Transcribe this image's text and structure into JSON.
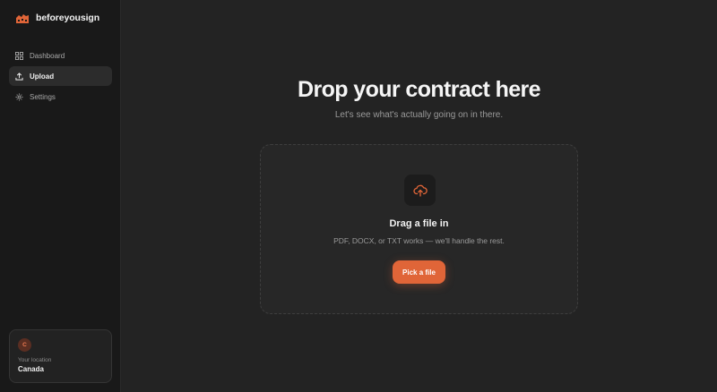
{
  "brand": {
    "name": "beforeyousign",
    "logo_icon": "building-logo-icon",
    "accent": "#e06538"
  },
  "sidebar": {
    "items": [
      {
        "label": "Dashboard",
        "icon": "grid-icon",
        "active": false
      },
      {
        "label": "Upload",
        "icon": "upload-icon",
        "active": true
      },
      {
        "label": "Settings",
        "icon": "gear-icon",
        "active": false
      }
    ],
    "location": {
      "avatar_initial": "C",
      "caption": "Your location",
      "value": "Canada"
    }
  },
  "main": {
    "title": "Drop your contract here",
    "subtitle": "Let's see what's actually going on in there.",
    "dropzone": {
      "icon": "cloud-upload-icon",
      "title": "Drag a file in",
      "hint": "PDF, DOCX, or TXT works — we'll handle the rest.",
      "button_label": "Pick a file"
    }
  }
}
